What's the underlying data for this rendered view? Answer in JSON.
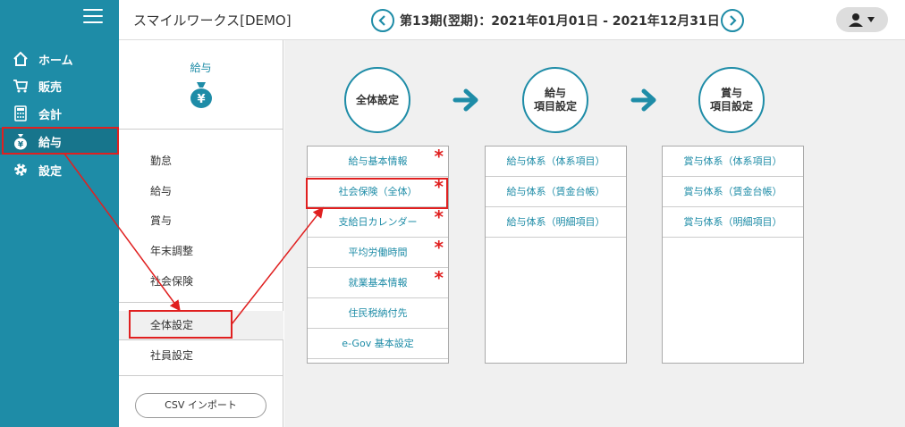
{
  "header": {
    "app_title": "スマイルワークス[DEMO]",
    "period": "第13期(翌期)：2021年01月01日 - 2021年12月31日"
  },
  "sidebar": {
    "items": [
      {
        "label": "ホーム",
        "icon": "home-icon"
      },
      {
        "label": "販売",
        "icon": "cart-icon"
      },
      {
        "label": "会計",
        "icon": "calculator-icon"
      },
      {
        "label": "給与",
        "icon": "money-bag-icon"
      },
      {
        "label": "設定",
        "icon": "gear-icon"
      }
    ]
  },
  "submenu": {
    "title": "給与",
    "items": [
      "勤怠",
      "給与",
      "賞与",
      "年末調整",
      "社会保険"
    ],
    "settings": [
      "全体設定",
      "社員設定"
    ],
    "csv_button": "CSV インポート"
  },
  "main": {
    "steps": [
      {
        "line1": "全体設定",
        "line2": ""
      },
      {
        "line1": "給与",
        "line2": "項目設定"
      },
      {
        "line1": "賞与",
        "line2": "項目設定"
      }
    ],
    "col1": [
      "給与基本情報",
      "社会保険（全体）",
      "支給日カレンダー",
      "平均労働時間",
      "就業基本情報",
      "住民税納付先",
      "e-Gov 基本設定"
    ],
    "col1_required": [
      true,
      true,
      true,
      true,
      true,
      false,
      false
    ],
    "col2": [
      "給与体系（体系項目）",
      "給与体系（賃金台帳）",
      "給与体系（明細項目）"
    ],
    "col3": [
      "賞与体系（体系項目）",
      "賞与体系（賃金台帳）",
      "賞与体系（明細項目）"
    ],
    "required_mark": "*"
  },
  "colors": {
    "brand": "#1e8ca7",
    "highlight": "#e02020"
  }
}
